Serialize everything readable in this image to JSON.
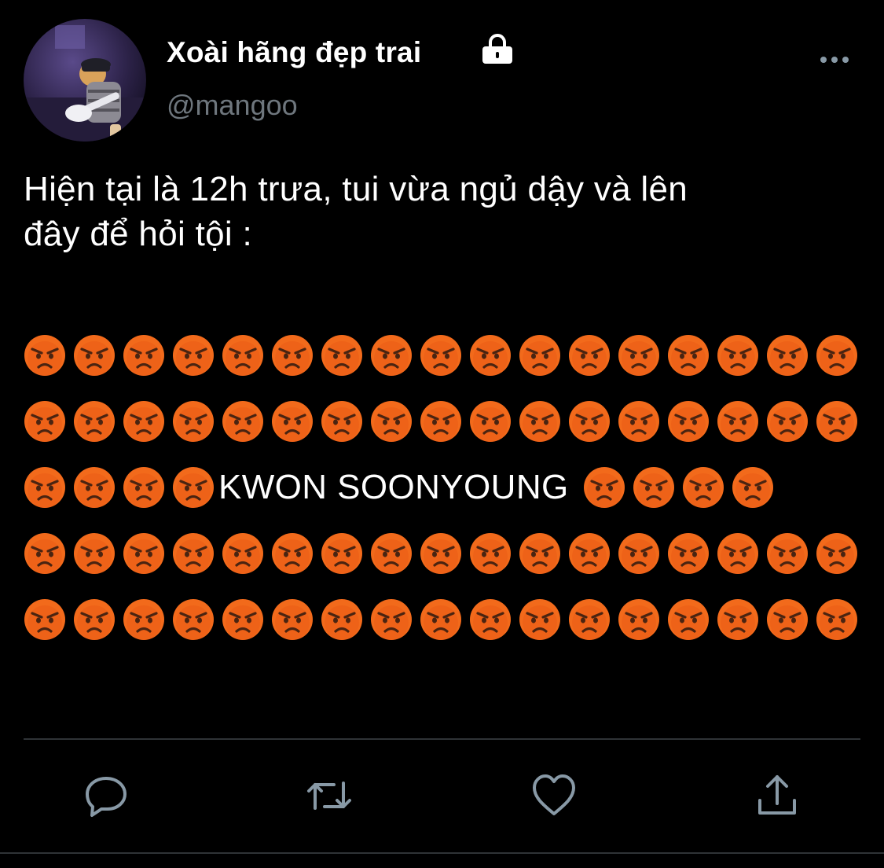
{
  "author": {
    "display_name": "Xoài hãng đẹp trai",
    "handle": "@mangoo",
    "protected_icon": "lock-icon"
  },
  "tweet": {
    "text": "Hiện tại là 12h trưa, tui vừa ngủ dậy và lên\nđây để hỏi tội :",
    "emoji_name": "angry-face-icon",
    "emoji_rows": [
      {
        "before": 17,
        "text": "",
        "after": 0
      },
      {
        "before": 17,
        "text": "",
        "after": 0
      },
      {
        "before": 4,
        "text": "KWON SOONYOUNG",
        "after": 4
      },
      {
        "before": 17,
        "text": "",
        "after": 0
      },
      {
        "before": 17,
        "text": "",
        "after": 0
      }
    ]
  },
  "actions": [
    "reply-icon",
    "retweet-icon",
    "like-icon",
    "share-icon"
  ],
  "colors": {
    "background": "#000000",
    "text": "#ffffff",
    "secondary_text": "#6e767d",
    "icon": "#8899a6",
    "divider": "#2f3336",
    "emoji_face": "#f26a1b"
  }
}
